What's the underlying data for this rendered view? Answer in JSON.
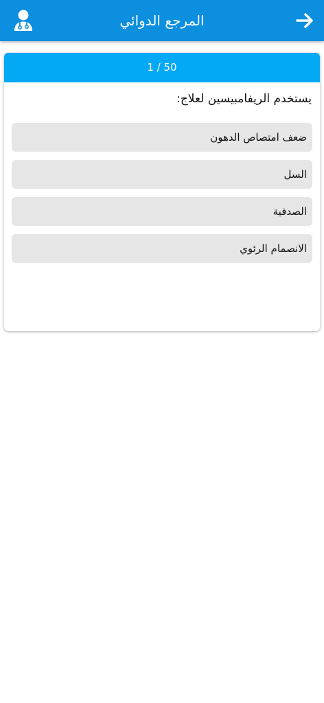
{
  "app_bar": {
    "title": "المرجع الدوائي",
    "back_icon": "arrow-right-icon",
    "profile_icon": "doctor-icon"
  },
  "quiz": {
    "progress_text": "1 / 50",
    "current_question": 1,
    "total_questions": 50,
    "question": "يستخدم الريفامبيسين لعلاج:",
    "options": [
      {
        "label": "ضعف امتصاص الدهون"
      },
      {
        "label": "السل"
      },
      {
        "label": "الصدفية"
      },
      {
        "label": "الانصمام الرئوي"
      }
    ]
  },
  "colors": {
    "app_bar": "#0b8fde",
    "card_header": "#03a9f4",
    "option_bg": "#e6e6e6"
  }
}
